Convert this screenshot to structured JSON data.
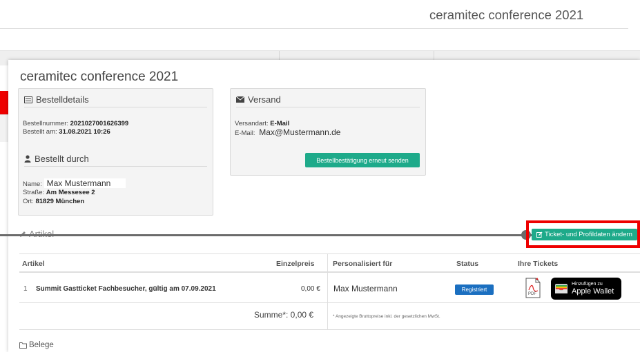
{
  "header": {
    "title": "ceramitec conference 2021"
  },
  "card": {
    "title": "ceramitec conference 2021"
  },
  "order_details": {
    "heading": "Bestelldetails",
    "order_number_label": "Bestellnummer:",
    "order_number": "2021027001626399",
    "ordered_on_label": "Bestellt am:",
    "ordered_on": "31.08.2021 10:26"
  },
  "ordered_by": {
    "heading": "Bestellt durch",
    "name_label": "Name:",
    "name": "Max Mustermann",
    "street_label": "Straße:",
    "street": "Am Messesee 2",
    "city_label": "Ort:",
    "city": "81829 München"
  },
  "shipping": {
    "heading": "Versand",
    "type_label": "Versandart:",
    "type": "E-Mail",
    "email_label": "E-Mail:",
    "email": "Max@Mustermann.de",
    "resend_button": "Bestellbestätigung erneut senden"
  },
  "articles": {
    "heading": "Artikel",
    "change_button": "Ticket- und Profildaten ändern",
    "columns": {
      "article": "Artikel",
      "unit_price": "Einzelpreis",
      "personalized_for": "Personalisiert für",
      "status": "Status",
      "tickets": "Ihre Tickets"
    },
    "rows": [
      {
        "index": "1",
        "name": "Summit Gastticket Fachbesucher, gültig am 07.09.2021",
        "price": "0,00 €",
        "person": "Max Mustermann",
        "status": "Registriert"
      }
    ],
    "sum": "Summe*: 0,00 €",
    "footnote": "* Angezeigte Bruttopreise inkl. der gesetzlichen MwSt."
  },
  "wallet": {
    "line1": "Hinzufügen zu",
    "line2": "Apple Wallet"
  },
  "pdf_label": "PDF",
  "receipts": {
    "label": "Belege"
  },
  "colors": {
    "accent_green": "#1eaa8a",
    "status_blue": "#1b6fc0",
    "highlight_red": "#ee0000"
  }
}
